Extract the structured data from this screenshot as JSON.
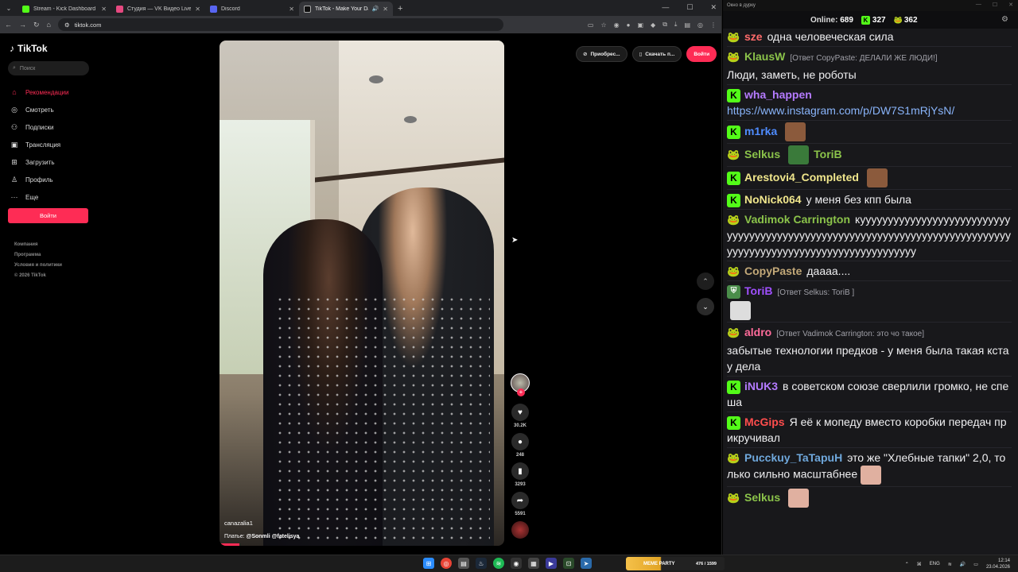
{
  "browser": {
    "tabs": [
      {
        "title": "Stream - Kick Dashboard",
        "color": "#53fc18"
      },
      {
        "title": "Студия — VK Видео Live",
        "color": "#e64980"
      },
      {
        "title": "Discord",
        "color": "#5865f2"
      },
      {
        "title": "TikTok - Make Your Day",
        "color": "#ffffff"
      }
    ],
    "url": "tiktok.com"
  },
  "tiktok": {
    "logo": "TikTok",
    "search_placeholder": "Поиск",
    "nav": [
      {
        "label": "Рекомендации",
        "icon": "home-icon"
      },
      {
        "label": "Смотреть",
        "icon": "compass-icon"
      },
      {
        "label": "Подписки",
        "icon": "users-icon"
      },
      {
        "label": "Трансляция",
        "icon": "live-icon"
      },
      {
        "label": "Загрузить",
        "icon": "upload-icon"
      },
      {
        "label": "Профиль",
        "icon": "profile-icon"
      },
      {
        "label": "Еще",
        "icon": "more-icon"
      }
    ],
    "login_label": "Войти",
    "footer": [
      "Компания",
      "Программа",
      "Условия и политики",
      "© 2026 TikTok"
    ],
    "topright": {
      "get_app": "Приобрес...",
      "download": "Скачать п...",
      "login": "Войти"
    },
    "video": {
      "username": "canazalia1",
      "caption_prefix": "Платье:",
      "caption_tags": "@Sonmli @fatelisya"
    },
    "counts": {
      "likes": "30.2K",
      "comments": "248",
      "saves": "3293",
      "shares": "5591"
    }
  },
  "chat": {
    "window_title": "Окно в дурку",
    "online_label": "Online:",
    "online": "689",
    "kick_count": "327",
    "pepe_count": "362",
    "messages": [
      {
        "badge": "pepe",
        "user": "sze",
        "color": "#ff6b6b",
        "text": "одна человеческая сила"
      },
      {
        "badge": "pepe",
        "user": "KlausW",
        "color": "#8bc34a",
        "reply": "[Ответ CopyPaste: ДЕЛАЛИ ЖЕ ЛЮДИ!]",
        "text": "Люди, заметь, не роботы"
      },
      {
        "badge": "kick",
        "user": "wha_happen",
        "color": "#b57bff",
        "link": "https://www.instagram.com/p/DW7S1mRjYsN/"
      },
      {
        "badge": "kick",
        "user": "m1rka",
        "color": "#4f8cff",
        "emote": "#8b5a3c"
      },
      {
        "badge": "pepe",
        "user": "Selkus",
        "color": "#8bc34a",
        "emote": "#3a7a3a",
        "text_user": "ToriB",
        "text_user_color": "#8bc34a"
      },
      {
        "badge": "kick",
        "user": "Arestovi4_Completed",
        "color": "#f0e68c",
        "emote": "#8b5a3c"
      },
      {
        "badge": "kick",
        "user": "NoNick064",
        "color": "#f0e68c",
        "text": "у меня без кпп была"
      },
      {
        "badge": "pepe",
        "user": "Vadimok Carrington",
        "color": "#8bc34a",
        "text": "куууууууууууууууууууууууууууууууууууууууууууууууууууууууууууууууууууууууууууууууууууууууууууууууууууууууууууууууу"
      },
      {
        "badge": "pepe",
        "user": "CopyPaste",
        "color": "#c2a878",
        "text": "даааа...."
      },
      {
        "badge": "shield",
        "user": "ToriB",
        "color": "#a050ff",
        "reply": "[Ответ Selkus: ToriB ]",
        "emote": "#dddddd"
      },
      {
        "badge": "pepe",
        "user": "aldro",
        "color": "#ff6b9a",
        "reply": "[Ответ Vadimok Carrington: это чо такое]",
        "text": "забытые технологии предков - у меня была такая кста у дела"
      },
      {
        "badge": "kick",
        "user": "iNUK3",
        "color": "#b57bff",
        "text": "в советском союзе сверлили громко, не спеша"
      },
      {
        "badge": "kick",
        "user": "McGips",
        "color": "#ff4d4d",
        "text": "Я её к мопеду вместо коробки передач прикручивал"
      },
      {
        "badge": "pepe",
        "user": "Pucckuy_TaTapuH",
        "color": "#6fa8dc",
        "text": "это же \"Хлебные тапки\" 2,0, только сильно масштабнее",
        "emote": "#e0b0a0"
      },
      {
        "badge": "pepe",
        "user": "Selkus",
        "color": "#8bc34a",
        "emote": "#e0b0a0"
      }
    ]
  },
  "taskbar": {
    "widget_title": "MEME PARTY",
    "widget_points": "476 / 1599",
    "lang": "ENG",
    "time": "12:14",
    "date": "23.04.2026"
  }
}
